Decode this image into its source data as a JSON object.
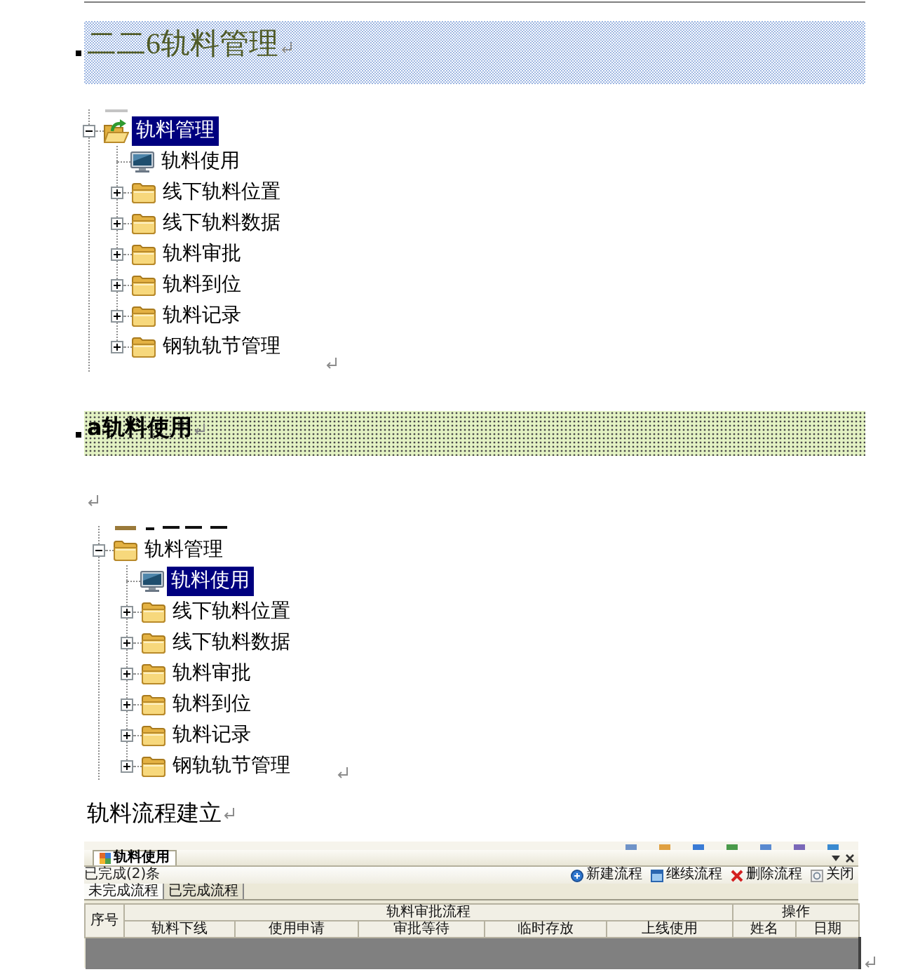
{
  "document": [
    {
      "kind": "heading1",
      "text": "二二6轨料管理"
    },
    {
      "kind": "tree",
      "items": [
        {
          "label": "轨料管理",
          "kind": "folder",
          "expanded": true,
          "selected": true,
          "children": [
            {
              "label": "轨料使用",
              "kind": "module",
              "selected": false
            },
            {
              "label": "线下轨料位置",
              "kind": "folder",
              "expanded": false,
              "selected": false
            },
            {
              "label": "线下轨料数据",
              "kind": "folder",
              "expanded": false,
              "selected": false
            },
            {
              "label": "轨料审批",
              "kind": "folder",
              "expanded": false,
              "selected": false
            },
            {
              "label": "轨料到位",
              "kind": "folder",
              "expanded": false,
              "selected": false
            },
            {
              "label": "轨料记录",
              "kind": "folder",
              "expanded": false,
              "selected": false
            },
            {
              "label": "钢轨轨节管理",
              "kind": "folder",
              "expanded": false,
              "selected": false
            }
          ]
        }
      ]
    },
    {
      "kind": "heading2",
      "text": "a轨料使用"
    },
    {
      "kind": "blank"
    },
    {
      "kind": "tree",
      "items": [
        {
          "label": "轨料管理",
          "kind": "folder",
          "expanded": true,
          "selected": false,
          "children": [
            {
              "label": "轨料使用",
              "kind": "module",
              "selected": true
            },
            {
              "label": "线下轨料位置",
              "kind": "folder",
              "expanded": false,
              "selected": false
            },
            {
              "label": "线下轨料数据",
              "kind": "folder",
              "expanded": false,
              "selected": false
            },
            {
              "label": "轨料审批",
              "kind": "folder",
              "expanded": false,
              "selected": false
            },
            {
              "label": "轨料到位",
              "kind": "folder",
              "expanded": false,
              "selected": false
            },
            {
              "label": "轨料记录",
              "kind": "folder",
              "expanded": false,
              "selected": false
            },
            {
              "label": "钢轨轨节管理",
              "kind": "folder",
              "expanded": false,
              "selected": false
            }
          ]
        }
      ]
    },
    {
      "kind": "paragraph",
      "text": "轨料流程建立"
    },
    {
      "kind": "app_screenshot",
      "tab": "轨料使用",
      "summary": "已完成(2)条",
      "buttons": [
        {
          "label": "新建流程",
          "kind": "new"
        },
        {
          "label": "继续流程",
          "kind": "continue"
        },
        {
          "label": "删除流程",
          "kind": "delete"
        },
        {
          "label": "关闭",
          "kind": "close"
        }
      ],
      "subtabs": [
        {
          "label": "未完成流程",
          "selected": true
        },
        {
          "label": "已完成流程",
          "selected": false
        }
      ],
      "table": {
        "row_header": "序号",
        "groups": [
          {
            "label": "轨料审批流程",
            "columns": [
              "轨料下线",
              "使用申请",
              "审批等待",
              "临时存放",
              "上线使用"
            ]
          },
          {
            "label": "操作",
            "columns": [
              "姓名",
              "日期"
            ]
          }
        ]
      }
    }
  ]
}
